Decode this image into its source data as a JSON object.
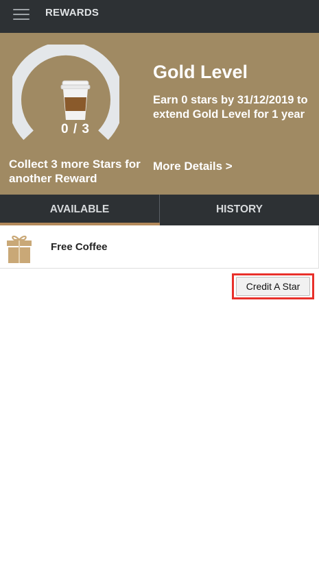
{
  "header": {
    "menu_icon": "hamburger-menu-icon",
    "title": "REWARDS"
  },
  "hero": {
    "progress": {
      "current": 0,
      "total": 3,
      "text": "0 / 3"
    },
    "cup_icon": "coffee-cup-icon",
    "collect_text": "Collect 3 more Stars for another Reward",
    "level_title": "Gold Level",
    "earn_text": "Earn 0 stars by 31/12/2019 to extend Gold Level for 1 year",
    "more_details": "More Details >"
  },
  "tabs": [
    {
      "label": "AVAILABLE",
      "active": true
    },
    {
      "label": "HISTORY",
      "active": false
    }
  ],
  "rewards": [
    {
      "name": "Free Coffee",
      "icon": "gift-box-icon"
    }
  ],
  "actions": {
    "credit_label": "Credit A Star"
  },
  "colors": {
    "topbar": "#2d3134",
    "hero": "#a08a63",
    "gauge_track": "#e4e7ea",
    "tab_underline": "#b3895a",
    "gift": "#c9a877",
    "highlight": "#e8302a"
  }
}
